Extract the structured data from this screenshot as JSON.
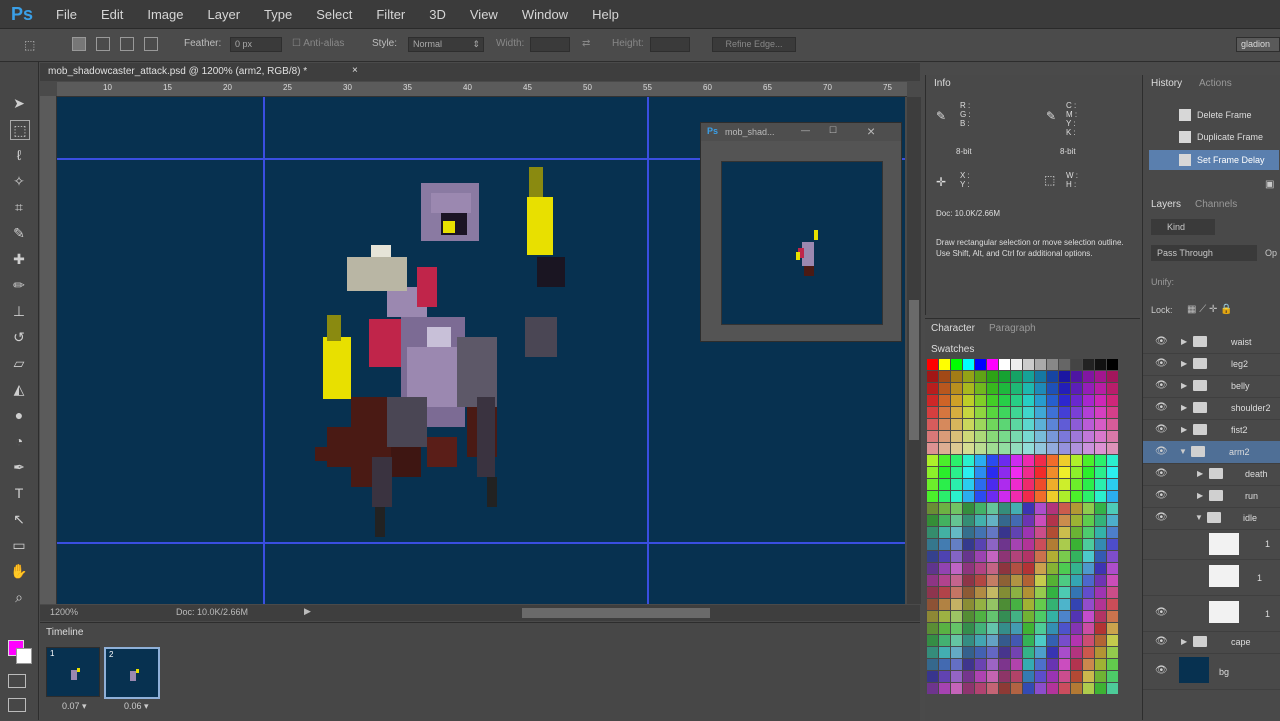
{
  "app": {
    "logo": "Ps"
  },
  "menu": [
    "File",
    "Edit",
    "Image",
    "Layer",
    "Type",
    "Select",
    "Filter",
    "3D",
    "View",
    "Window",
    "Help"
  ],
  "options": {
    "feather_label": "Feather:",
    "feather_value": "0 px",
    "anti_alias": "Anti-alias",
    "style_label": "Style:",
    "style_value": "Normal",
    "width_label": "Width:",
    "height_label": "Height:",
    "refine_edge": "Refine Edge...",
    "workspace": "gladion"
  },
  "document": {
    "tab_title": "mob_shadowcaster_attack.psd @ 1200% (arm2, RGB/8) *",
    "zoom": "1200%",
    "doc_size": "Doc: 10.0K/2.66M",
    "ruler_ticks": [
      "10",
      "15",
      "20",
      "25",
      "30",
      "35",
      "40",
      "45",
      "50",
      "55",
      "60",
      "65",
      "70",
      "75"
    ],
    "canvas_color": "#073150",
    "guide_color": "#3a4ee0"
  },
  "preview": {
    "title": "mob_shad..."
  },
  "timeline": {
    "tab": "Timeline",
    "frames": [
      {
        "num": "1",
        "delay": "0.07 ▾"
      },
      {
        "num": "2",
        "delay": "0.06 ▾"
      }
    ]
  },
  "info": {
    "tab": "Info",
    "rgb": "R :\nG :\nB :",
    "cmyk": "C :\nM :\nY :\nK :",
    "bit1": "8-bit",
    "bit2": "8-bit",
    "xy": "X :\nY :",
    "wh": "W :\nH :",
    "doc": "Doc: 10.0K/2.66M",
    "hint": "Draw rectangular selection or move selection outline. Use Shift, Alt, and Ctrl for additional options."
  },
  "character": {
    "tab1": "Character",
    "tab2": "Paragraph",
    "swatches_tab": "Swatches"
  },
  "history": {
    "tab1": "History",
    "tab2": "Actions",
    "items": [
      "Delete Frame",
      "Duplicate Frame",
      "Set Frame Delay"
    ]
  },
  "layers": {
    "tab1": "Layers",
    "tab2": "Channels",
    "kind": "Kind",
    "blend": "Pass Through",
    "opacity_short": "Op",
    "unify": "Unify:",
    "lock": "Lock:",
    "rows": [
      {
        "name": "waist",
        "type": "folder"
      },
      {
        "name": "leg2",
        "type": "folder"
      },
      {
        "name": "belly",
        "type": "folder"
      },
      {
        "name": "shoulder2",
        "type": "folder"
      },
      {
        "name": "fist2",
        "type": "folder"
      },
      {
        "name": "arm2",
        "type": "folder-open-selected"
      },
      {
        "name": "death",
        "type": "subfolder"
      },
      {
        "name": "run",
        "type": "subfolder"
      },
      {
        "name": "idle",
        "type": "subfolder-open"
      },
      {
        "name": "1",
        "type": "thumb"
      },
      {
        "name": "1",
        "type": "thumb"
      },
      {
        "name": "1",
        "type": "thumb"
      },
      {
        "name": "cape",
        "type": "folder"
      },
      {
        "name": "bg",
        "type": "bg"
      }
    ]
  }
}
